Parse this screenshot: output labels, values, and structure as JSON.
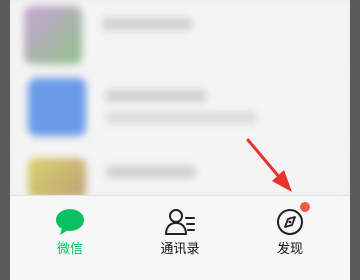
{
  "tabbar": {
    "tabs": [
      {
        "id": "chats",
        "label": "微信",
        "icon": "chat-bubble-icon",
        "active": true
      },
      {
        "id": "contacts",
        "label": "通讯录",
        "icon": "contacts-icon",
        "active": false
      },
      {
        "id": "discover",
        "label": "发现",
        "icon": "compass-icon",
        "active": false,
        "badge": true
      }
    ]
  },
  "colors": {
    "accent": "#07c160",
    "badge": "#f05a4b",
    "annotation_arrow": "#e8322d"
  }
}
